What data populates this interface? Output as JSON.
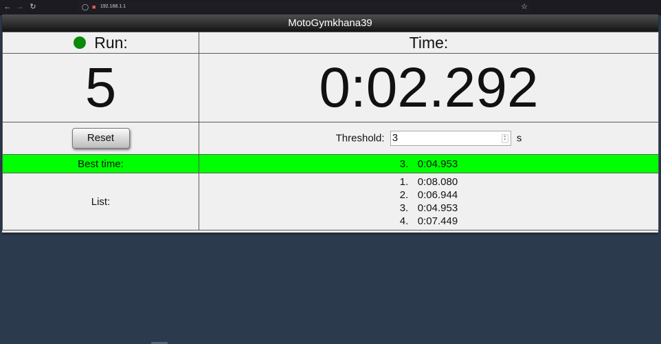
{
  "browser": {
    "url": "192.168.1.1",
    "icons": [
      "back-icon",
      "forward-icon",
      "reload-icon",
      "shield-icon",
      "lock-icon",
      "star-icon"
    ]
  },
  "app": {
    "title": "MotoGymkhana39",
    "run_label": "Run:",
    "time_label": "Time:",
    "run_count": "5",
    "current_time": "0:02.292",
    "reset_label": "Reset",
    "threshold_label": "Threshold:",
    "threshold_value": "3",
    "threshold_unit": "s",
    "best_label": "Best time:",
    "best": {
      "num": "3.",
      "time": "0:04.953"
    },
    "list_label": "List:",
    "list": [
      {
        "num": "1.",
        "time": "0:08.080"
      },
      {
        "num": "2.",
        "time": "0:06.944"
      },
      {
        "num": "3.",
        "time": "0:04.953"
      },
      {
        "num": "4.",
        "time": "0:07.449"
      }
    ]
  },
  "colors": {
    "status_dot": "#0a8a0a",
    "best_row": "#00ff00",
    "page_background": "#2c3a4e"
  }
}
